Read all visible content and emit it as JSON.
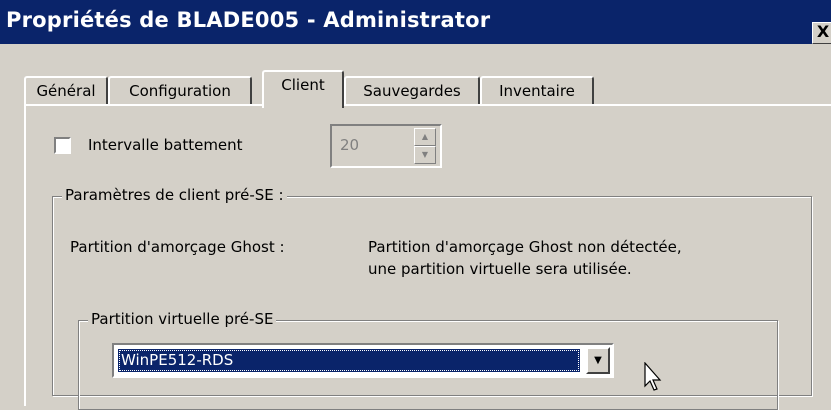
{
  "window": {
    "title": "Propriétés de BLADE005 - Administrator",
    "close_glyph": "X"
  },
  "tabs": [
    {
      "label": "Général",
      "active": false
    },
    {
      "label": "Configuration",
      "active": false
    },
    {
      "label": "Client",
      "active": true
    },
    {
      "label": "Sauvegardes",
      "active": false
    },
    {
      "label": "Inventaire",
      "active": false
    }
  ],
  "heartbeat": {
    "checkbox_label": "Intervalle battement",
    "checked": false,
    "value": "20",
    "up_glyph": "▲",
    "down_glyph": "▼"
  },
  "client_settings": {
    "legend": "Paramètres de client pré-SE :",
    "ghost_partition_label": "Partition d'amorçage Ghost :",
    "ghost_partition_line1": "Partition d'amorçage Ghost non détectée,",
    "ghost_partition_line2": "une partition virtuelle sera utilisée."
  },
  "virtual_partition": {
    "legend": "Partition virtuelle pré-SE",
    "selected": "WinPE512-RDS",
    "drop_glyph": "▼"
  }
}
